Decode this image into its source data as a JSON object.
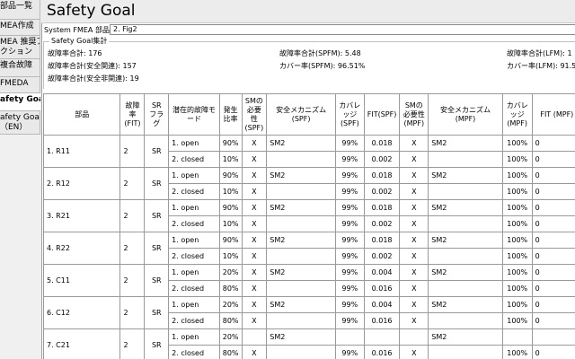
{
  "sidebar": {
    "tabs": [
      {
        "line1": "部品一覧",
        "line2": ""
      },
      {
        "line1": "MEA作成",
        "line2": ""
      },
      {
        "line1": "MEA 推奨ア",
        "line2": "クション"
      },
      {
        "line1": "複合故障",
        "line2": ""
      },
      {
        "line1": "FMEDA",
        "line2": ""
      },
      {
        "line1": "afety Goal",
        "line2": ""
      },
      {
        "line1": "afety Goal",
        "line2": "（EN）"
      }
    ]
  },
  "header": {
    "title": "Safety Goal"
  },
  "system_fmea": {
    "label": "System FMEA 部品:",
    "value": "2. Fig2"
  },
  "summary": {
    "legend": "Safety Goal集計",
    "fit_total": "故障率合計: 176",
    "fit_safety": "故障率合計(安全関連): 157",
    "fit_nonsafety": "故障率合計(安全非関連): 19",
    "spfm_fit": "故障率合計(SPFM): 5.48",
    "spfm_cov": "カバー率(SPFM): 96.51%",
    "lfm_fit": "故障率合計(LFM): 1",
    "lfm_cov": "カバー率(LFM): 91.5"
  },
  "table": {
    "headers": [
      "部品",
      "故障率 (FIT)",
      "SR フラグ",
      "潜在的故障モード",
      "発生比率",
      "SMの必要性 (SPF)",
      "安全メカニズム (SPF)",
      "カバレッジ (SPF)",
      "FIT(SPF)",
      "SMの必要性 (MPF)",
      "安全メカニズム (MPF)",
      "カバレッジ (MPF)",
      "FIT (MPF)"
    ],
    "rows": [
      {
        "part": "1. R11",
        "fit": "2",
        "sr": "SR",
        "modes": [
          {
            "mode": "1. open",
            "ratio": "90%",
            "sm_spf": "X",
            "mech_spf": "SM2",
            "cov_spf": "99%",
            "fit_spf": "0.018",
            "sm_mpf": "X",
            "mech_mpf": "SM2",
            "cov_mpf": "100%",
            "fit_mpf": "0"
          },
          {
            "mode": "2. closed",
            "ratio": "10%",
            "sm_spf": "X",
            "mech_spf": "",
            "cov_spf": "99%",
            "fit_spf": "0.002",
            "sm_mpf": "X",
            "mech_mpf": "",
            "cov_mpf": "100%",
            "fit_mpf": "0"
          }
        ]
      },
      {
        "part": "2. R12",
        "fit": "2",
        "sr": "SR",
        "modes": [
          {
            "mode": "1. open",
            "ratio": "90%",
            "sm_spf": "X",
            "mech_spf": "SM2",
            "cov_spf": "99%",
            "fit_spf": "0.018",
            "sm_mpf": "X",
            "mech_mpf": "SM2",
            "cov_mpf": "100%",
            "fit_mpf": "0"
          },
          {
            "mode": "2. closed",
            "ratio": "10%",
            "sm_spf": "X",
            "mech_spf": "",
            "cov_spf": "99%",
            "fit_spf": "0.002",
            "sm_mpf": "X",
            "mech_mpf": "",
            "cov_mpf": "100%",
            "fit_mpf": "0"
          }
        ]
      },
      {
        "part": "3. R21",
        "fit": "2",
        "sr": "SR",
        "modes": [
          {
            "mode": "1. open",
            "ratio": "90%",
            "sm_spf": "X",
            "mech_spf": "SM2",
            "cov_spf": "99%",
            "fit_spf": "0.018",
            "sm_mpf": "X",
            "mech_mpf": "SM2",
            "cov_mpf": "100%",
            "fit_mpf": "0"
          },
          {
            "mode": "2. closed",
            "ratio": "10%",
            "sm_spf": "X",
            "mech_spf": "",
            "cov_spf": "99%",
            "fit_spf": "0.002",
            "sm_mpf": "X",
            "mech_mpf": "",
            "cov_mpf": "100%",
            "fit_mpf": "0"
          }
        ]
      },
      {
        "part": "4. R22",
        "fit": "2",
        "sr": "SR",
        "modes": [
          {
            "mode": "1. open",
            "ratio": "90%",
            "sm_spf": "X",
            "mech_spf": "SM2",
            "cov_spf": "99%",
            "fit_spf": "0.018",
            "sm_mpf": "X",
            "mech_mpf": "SM2",
            "cov_mpf": "100%",
            "fit_mpf": "0"
          },
          {
            "mode": "2. closed",
            "ratio": "10%",
            "sm_spf": "X",
            "mech_spf": "",
            "cov_spf": "99%",
            "fit_spf": "0.002",
            "sm_mpf": "X",
            "mech_mpf": "",
            "cov_mpf": "100%",
            "fit_mpf": "0"
          }
        ]
      },
      {
        "part": "5. C11",
        "fit": "2",
        "sr": "SR",
        "modes": [
          {
            "mode": "1. open",
            "ratio": "20%",
            "sm_spf": "X",
            "mech_spf": "SM2",
            "cov_spf": "99%",
            "fit_spf": "0.004",
            "sm_mpf": "X",
            "mech_mpf": "SM2",
            "cov_mpf": "100%",
            "fit_mpf": "0"
          },
          {
            "mode": "2. closed",
            "ratio": "80%",
            "sm_spf": "X",
            "mech_spf": "",
            "cov_spf": "99%",
            "fit_spf": "0.016",
            "sm_mpf": "X",
            "mech_mpf": "",
            "cov_mpf": "100%",
            "fit_mpf": "0"
          }
        ]
      },
      {
        "part": "6. C12",
        "fit": "2",
        "sr": "SR",
        "modes": [
          {
            "mode": "1. open",
            "ratio": "20%",
            "sm_spf": "X",
            "mech_spf": "SM2",
            "cov_spf": "99%",
            "fit_spf": "0.004",
            "sm_mpf": "X",
            "mech_mpf": "SM2",
            "cov_mpf": "100%",
            "fit_mpf": "0"
          },
          {
            "mode": "2. closed",
            "ratio": "80%",
            "sm_spf": "X",
            "mech_spf": "",
            "cov_spf": "99%",
            "fit_spf": "0.016",
            "sm_mpf": "X",
            "mech_mpf": "",
            "cov_mpf": "100%",
            "fit_mpf": "0"
          }
        ]
      },
      {
        "part": "7. C21",
        "fit": "2",
        "sr": "SR",
        "modes": [
          {
            "mode": "1. open",
            "ratio": "20%",
            "sm_spf": "",
            "mech_spf": "SM2",
            "cov_spf": "",
            "fit_spf": "",
            "sm_mpf": "",
            "mech_mpf": "SM2",
            "cov_mpf": "",
            "fit_mpf": ""
          },
          {
            "mode": "2. closed",
            "ratio": "80%",
            "sm_spf": "X",
            "mech_spf": "",
            "cov_spf": "99%",
            "fit_spf": "0.016",
            "sm_mpf": "X",
            "mech_mpf": "",
            "cov_mpf": "100%",
            "fit_mpf": "0"
          }
        ]
      }
    ]
  }
}
